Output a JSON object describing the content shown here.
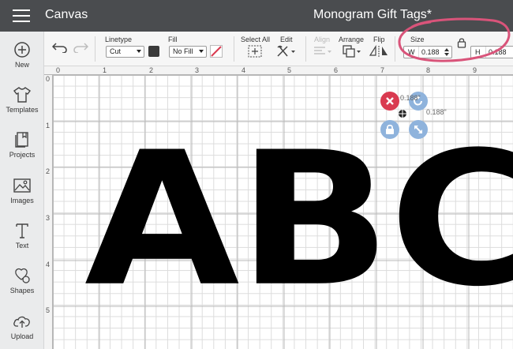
{
  "header": {
    "app_title": "Canvas",
    "doc_title": "Monogram Gift Tags*"
  },
  "sidebar": {
    "items": [
      {
        "label": "New",
        "icon": "plus-circle-icon"
      },
      {
        "label": "Templates",
        "icon": "tshirt-icon"
      },
      {
        "label": "Projects",
        "icon": "projects-icon"
      },
      {
        "label": "Images",
        "icon": "image-icon"
      },
      {
        "label": "Text",
        "icon": "text-icon"
      },
      {
        "label": "Shapes",
        "icon": "shapes-icon"
      },
      {
        "label": "Upload",
        "icon": "upload-icon"
      }
    ]
  },
  "toolbar": {
    "linetype_label": "Linetype",
    "linetype_value": "Cut",
    "fill_label": "Fill",
    "fill_value": "No Fill",
    "fill_color": "#3a3a3a",
    "select_all_label": "Select All",
    "edit_label": "Edit",
    "align_label": "Align",
    "arrange_label": "Arrange",
    "flip_label": "Flip",
    "size_label": "Size",
    "width_label": "W",
    "width_value": "0.188",
    "height_label": "H",
    "height_value": "0.188"
  },
  "rulers": {
    "top": [
      "0",
      "1",
      "2",
      "3",
      "4",
      "5",
      "6",
      "7",
      "8",
      "9"
    ],
    "left": [
      "0",
      "1",
      "2",
      "3",
      "4",
      "5"
    ]
  },
  "canvas": {
    "letters": "ABC",
    "selection_width_label": "0.188\"",
    "selection_height_label": "0.188\""
  },
  "colors": {
    "header_bg": "#4a4c4f",
    "delete_handle": "#d93a50",
    "handle_blue": "#8fb3dc",
    "annotation": "#d9547a"
  }
}
